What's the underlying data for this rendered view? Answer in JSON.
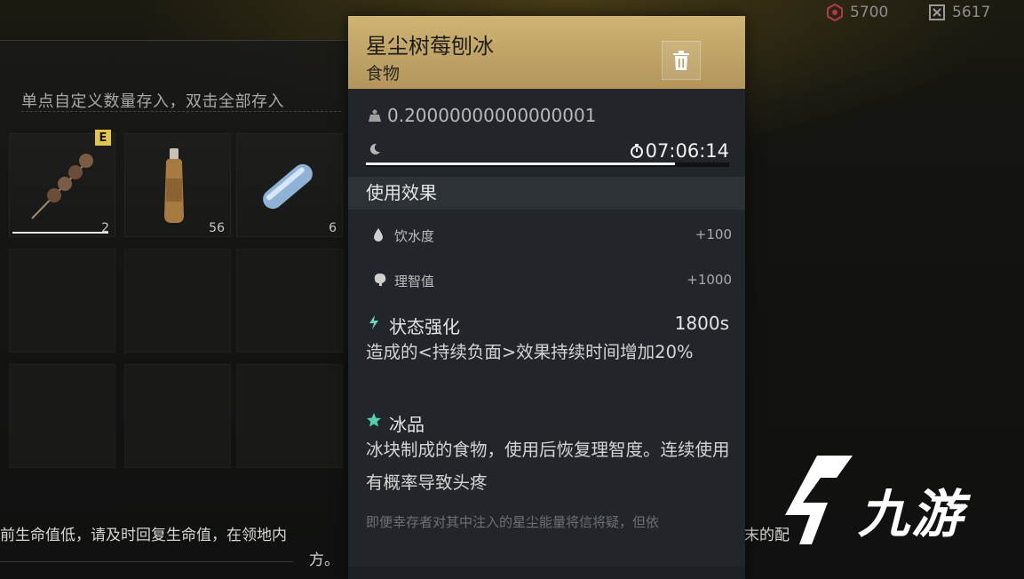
{
  "currencies": [
    {
      "icon": "gear-coin-icon",
      "value": "5700"
    },
    {
      "icon": "frame-coin-icon",
      "value": "5617"
    }
  ],
  "storage": {
    "hint": "单点自定义数量存入，双击全部存入",
    "items": [
      {
        "name": "skewer",
        "count": "2",
        "badge": "E"
      },
      {
        "name": "bottle",
        "count": "56"
      },
      {
        "name": "capsule",
        "count": "6"
      }
    ]
  },
  "detail": {
    "title": "星尘树莓刨冰",
    "category": "食物",
    "weight": "0.20000000000000001",
    "timer": "07:06:14",
    "progress": 0.85,
    "section_title": "使用效果",
    "effects": [
      {
        "icon": "water-drop-icon",
        "label": "饮水度",
        "value": "+100"
      },
      {
        "icon": "brain-icon",
        "label": "理智值",
        "value": "+1000"
      }
    ],
    "traits": [
      {
        "icon": "buff-icon",
        "title": "状态强化",
        "value": "1800s",
        "desc": "造成的<持续负面>效果持续时间增加20%"
      },
      {
        "icon": "star-icon",
        "title": "冰品",
        "value": "",
        "desc": "冰块制成的食物，使用后恢复理智度。连续使用有概率导致头疼"
      }
    ],
    "lore": "即便幸存者对其中注入的星尘能量将信将疑，但依"
  },
  "bottom_message": {
    "line1": "前生命值低，请及时回复生命值，在领地内",
    "line2": "方。",
    "right": "末的配"
  },
  "watermark": "九游",
  "colors": {
    "header_gold": "#c6a96a",
    "badge_yellow": "#e3c54a",
    "card_bg": "#22262a"
  }
}
